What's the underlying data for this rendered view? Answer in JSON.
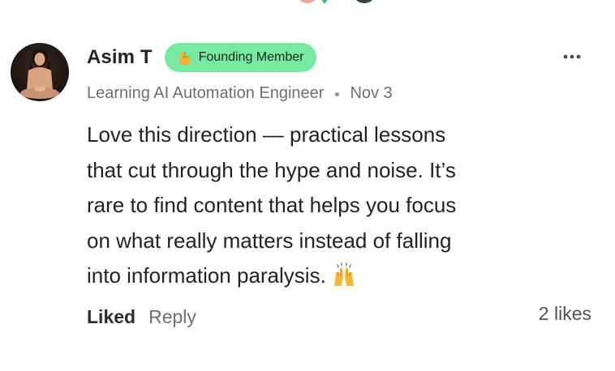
{
  "comment": {
    "author": "Asim T",
    "badge": {
      "label": "Founding Member",
      "icon": "flexed-biceps-icon",
      "color": "#76eaa0"
    },
    "subtitle": "Learning AI Automation Engineer",
    "date": "Nov 3",
    "body": "Love this direction — practical lessons\nthat cut through the hype and noise. It’s\nrare to find content that helps you focus\non what really matters instead of falling\ninto information paralysis.",
    "body_emoji": "raising-hands-icon",
    "actions": {
      "liked_label": "Liked",
      "reply_label": "Reply"
    },
    "likes": "2 likes",
    "more_icon": "more-horizontal-icon"
  }
}
